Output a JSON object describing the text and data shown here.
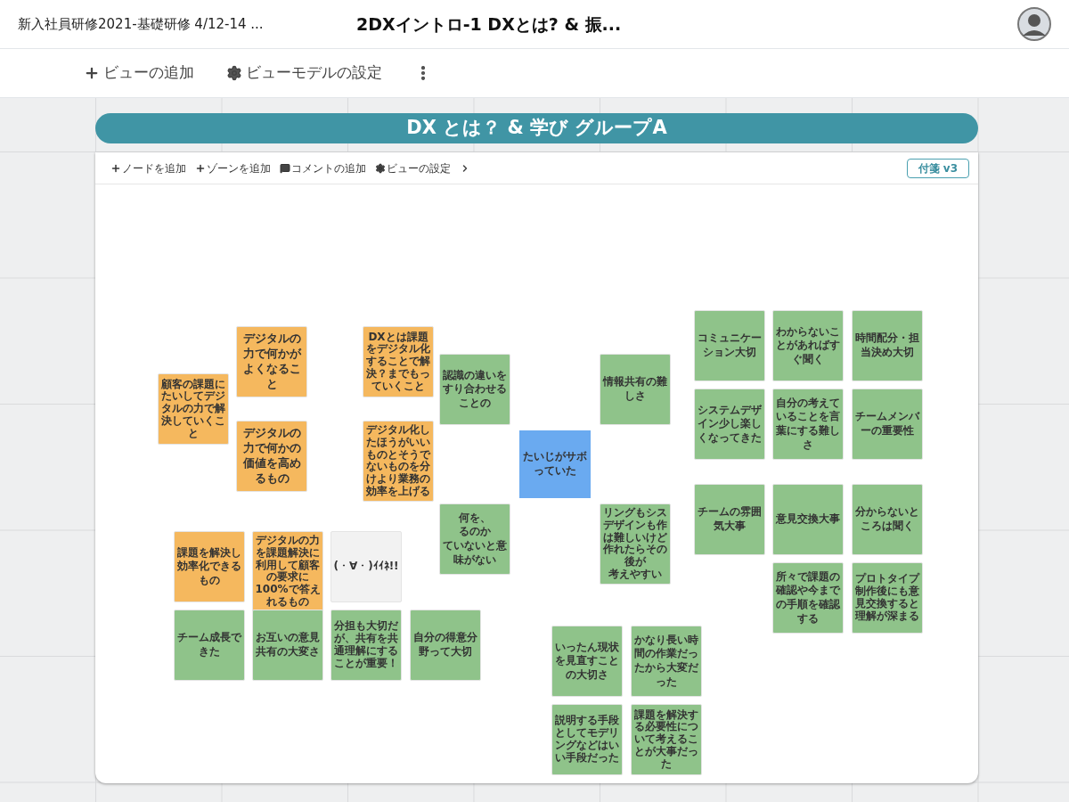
{
  "header": {
    "breadcrumb": "新入社員研修2021-基礎研修 4/12-14 ...",
    "title": "2DXイントロ-1 DXとは? & 振..."
  },
  "view_toolbar": [
    {
      "kind": "plus",
      "label": "ビューの追加"
    },
    {
      "kind": "gear",
      "label": "ビューモデルの設定"
    },
    {
      "kind": "more"
    }
  ],
  "board": {
    "title": "DX とは？ & 学び グループA",
    "toolbar": [
      {
        "kind": "plus",
        "label": "ノードを追加"
      },
      {
        "kind": "plus",
        "label": "ゾーンを追加"
      },
      {
        "kind": "comment",
        "label": "コメントの追加"
      },
      {
        "kind": "gear",
        "label": "ビューの設定"
      },
      {
        "kind": "caret"
      }
    ],
    "badge": "付箋 v3",
    "notes": [
      {
        "lines": [
          "顧客の課題にたいしてデジタルの力で解決していくこと"
        ],
        "color": "#f5b85e"
      },
      {
        "lines": [
          "デジタルの力で何かがよくなること"
        ],
        "color": "#f5b85e"
      },
      {
        "lines": [
          "DXとは課題をデジタル化することで解決？までもっていくこと"
        ],
        "color": "#f5b85e"
      },
      {
        "lines": [
          "デジタルの力で何かの価値を高めるもの"
        ],
        "color": "#f5b85e"
      },
      {
        "lines": [
          "デジタル化したほうがいいものとそうでないものを分けより業務の効率を上げる"
        ],
        "color": "#f5b85e"
      },
      {
        "lines": [
          "課題を解決し効率化できるもの"
        ],
        "color": "#f5b85e"
      },
      {
        "lines": [
          "デジタルの力を課題解決に利用して顧客の要求に100%で答えれるもの"
        ],
        "color": "#f5b85e"
      },
      {
        "lines": [
          "(・∀・)ｲｲﾈ!!"
        ],
        "color": "#f2f2f2"
      },
      {
        "lines": [
          "チーム成長できた"
        ],
        "color": "#8fc38a"
      },
      {
        "lines": [
          "お互いの意見共有の大変さ"
        ],
        "color": "#8fc38a"
      },
      {
        "lines": [
          "分担も大切だが、共有を共通理解にすることが重要！"
        ],
        "color": "#8fc38a"
      },
      {
        "lines": [
          "自分の得意分野って大切"
        ],
        "color": "#8fc38a"
      },
      {
        "lines": [
          "認識の違いを",
          "すり合わせる",
          "ことの"
        ],
        "color": "#8fc38a"
      },
      {
        "lines": [
          "情報共有の難しさ"
        ],
        "color": "#8fc38a"
      },
      {
        "lines": [
          "何を、",
          "るのか",
          "ていないと意",
          "味がない"
        ],
        "color": "#8fc38a"
      },
      {
        "lines": [
          "リングもシス",
          "デザインも作",
          "は難しいけど",
          "作れたらその後が",
          "考えやすい"
        ],
        "color": "#8fc38a"
      },
      {
        "lines": [
          "いったん現状を見直すことの大切さ"
        ],
        "color": "#8fc38a"
      },
      {
        "lines": [
          "かなり長い時間の作業だったから大変だった"
        ],
        "color": "#8fc38a"
      },
      {
        "lines": [
          "説明する手段としてモデリングなどはいい手段だった"
        ],
        "color": "#8fc38a"
      },
      {
        "lines": [
          "課題を解決する必要性について考えることが大事だった"
        ],
        "color": "#8fc38a"
      },
      {
        "lines": [
          "コミュニケーション大切"
        ],
        "color": "#8fc38a"
      },
      {
        "lines": [
          "わからないことがあればすぐ聞く"
        ],
        "color": "#8fc38a"
      },
      {
        "lines": [
          "時間配分・担当決め大切"
        ],
        "color": "#8fc38a"
      },
      {
        "lines": [
          "システムデザイン少し楽しくなってきた"
        ],
        "color": "#8fc38a"
      },
      {
        "lines": [
          "自分の考えていることを言葉にする難しさ"
        ],
        "color": "#8fc38a"
      },
      {
        "lines": [
          "チームメンバーの重要性"
        ],
        "color": "#8fc38a"
      },
      {
        "lines": [
          "チームの雰囲気大事"
        ],
        "color": "#8fc38a"
      },
      {
        "lines": [
          "意見交換大事"
        ],
        "color": "#8fc38a"
      },
      {
        "lines": [
          "分からないところは聞く"
        ],
        "color": "#8fc38a"
      },
      {
        "lines": [
          "所々で課題の確認や今までの手順を確認する"
        ],
        "color": "#8fc38a"
      },
      {
        "lines": [
          "プロトタイプ制作後にも意見交換すると理解が深まる"
        ],
        "color": "#8fc38a"
      },
      {
        "lines": [
          "たいじがサボっていた"
        ],
        "color": "#6aaaf0"
      }
    ]
  }
}
